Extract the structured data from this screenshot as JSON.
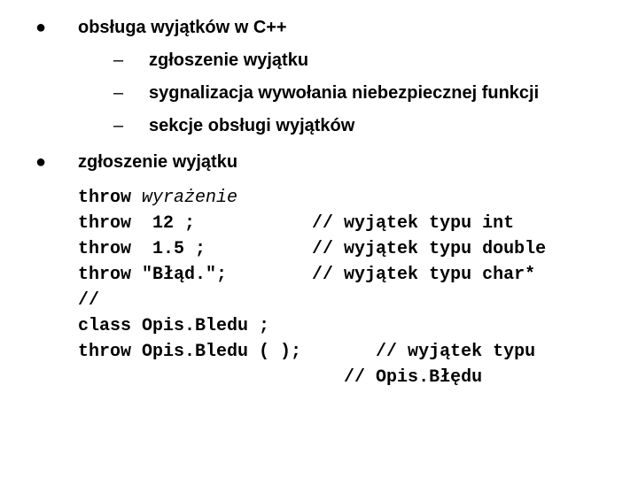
{
  "bullets": [
    {
      "text": "obsługa wyjątków w C++",
      "subs": [
        "zgłoszenie wyjątku",
        "sygnalizacja wywołania niebezpiecznej funkcji",
        "sekcje obsługi wyjątków"
      ]
    },
    {
      "text": "zgłoszenie wyjątku",
      "subs": []
    }
  ],
  "code": {
    "l0a": "throw ",
    "l0b": "wyrażenie",
    "l1": "throw  12 ;           // wyjątek typu int",
    "l2": "throw  1.5 ;          // wyjątek typu double",
    "l3": "throw \"Błąd.\";        // wyjątek typu char*",
    "l4": "//",
    "l5": "class Opis.Bledu ;",
    "l6": "throw Opis.Bledu ( );       // wyjątek typu",
    "l7": "                         // Opis.Błędu"
  },
  "marks": {
    "dot": "●",
    "dash": "–"
  }
}
